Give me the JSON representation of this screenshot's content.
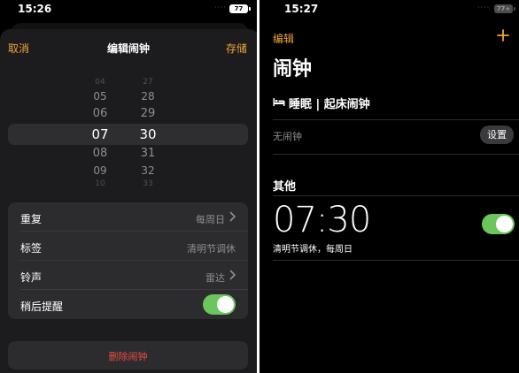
{
  "left": {
    "status": {
      "time": "15:26",
      "battery": "77"
    },
    "nav": {
      "cancel": "取消",
      "title": "编辑闹钟",
      "save": "存储"
    },
    "picker": {
      "hours": [
        "04",
        "05",
        "06",
        "07",
        "08",
        "09",
        "10"
      ],
      "minutes": [
        "27",
        "28",
        "29",
        "30",
        "31",
        "32",
        "33"
      ],
      "selected_hour": "07",
      "selected_minute": "30"
    },
    "settings": {
      "repeat": {
        "label": "重复",
        "value": "每周日"
      },
      "tag": {
        "label": "标签",
        "value": "清明节调休"
      },
      "sound": {
        "label": "铃声",
        "value": "雷达"
      },
      "snooze": {
        "label": "稍后提醒",
        "enabled": true
      }
    },
    "delete_label": "删除闹钟"
  },
  "right": {
    "status": {
      "time": "15:27",
      "battery": "77+"
    },
    "edit": "编辑",
    "add_icon": "plus-icon",
    "title": "闹钟",
    "sleep_section": {
      "icon": "bed-icon",
      "label": "睡眠 | 起床闹钟",
      "no_alarm": "无闹钟",
      "set_button": "设置"
    },
    "other_section": "其他",
    "alarm": {
      "time": "07:30",
      "label": "清明节调休，每周日",
      "enabled": true
    }
  },
  "colors": {
    "accent": "#f2a33a",
    "toggle_on": "#6cc65e",
    "destructive": "#eb4c42",
    "secondary_text": "#8e8e93"
  }
}
